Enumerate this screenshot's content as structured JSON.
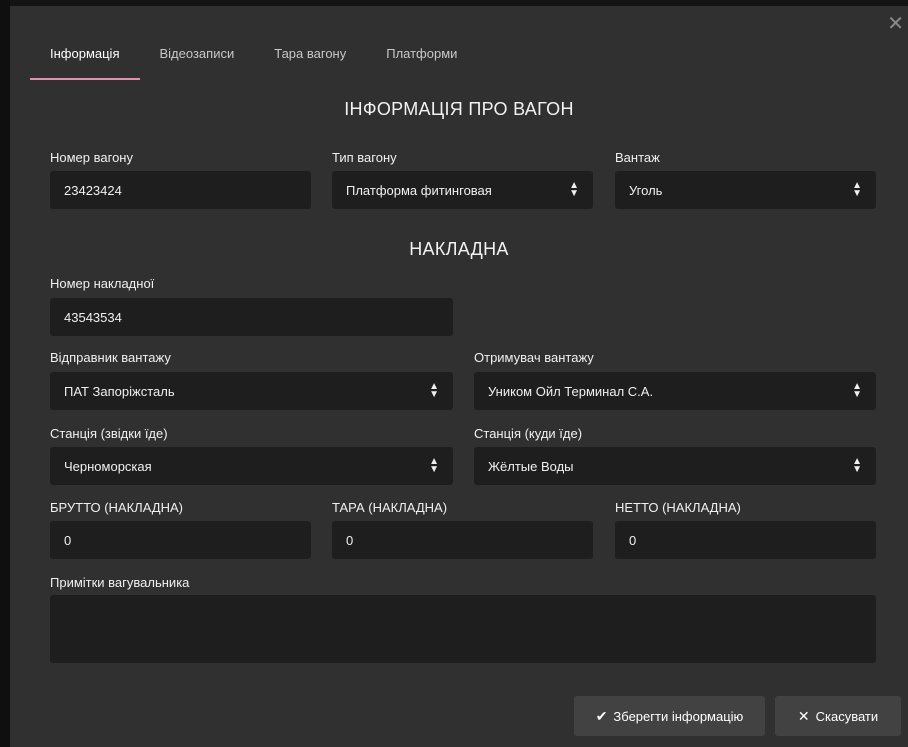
{
  "tabs": [
    {
      "label": "Інформація",
      "active": true
    },
    {
      "label": "Відеозаписи",
      "active": false
    },
    {
      "label": "Тара вагону",
      "active": false
    },
    {
      "label": "Платформи",
      "active": false
    }
  ],
  "wagon_section": {
    "title": "ІНФОРМАЦІЯ ПРО ВАГОН",
    "wagon_number": {
      "label": "Номер вагону",
      "value": "23423424"
    },
    "wagon_type": {
      "label": "Тип вагону",
      "value": "Платформа фитинговая"
    },
    "cargo": {
      "label": "Вантаж",
      "value": "Уголь"
    }
  },
  "invoice_section": {
    "title": "НАКЛАДНА",
    "invoice_number": {
      "label": "Номер накладної",
      "value": "43543534"
    },
    "sender": {
      "label": "Відправник вантажу",
      "value": "ПАТ Запоріжсталь"
    },
    "receiver": {
      "label": "Отримувач вантажу",
      "value": "Уником Ойл Терминал С.А."
    },
    "station_from": {
      "label": "Станція (звідки їде)",
      "value": "Черноморская"
    },
    "station_to": {
      "label": "Станція (куди їде)",
      "value": "Жёлтые Воды"
    },
    "gross": {
      "label": "БРУТТО (НАКЛАДНА)",
      "value": "0"
    },
    "tare": {
      "label": "ТАРА (НАКЛАДНА)",
      "value": "0"
    },
    "net": {
      "label": "НЕТТО (НАКЛАДНА)",
      "value": "0"
    },
    "notes": {
      "label": "Примітки вагувальника",
      "value": ""
    }
  },
  "buttons": {
    "save": "Зберегти інформацію",
    "cancel": "Скасувати"
  },
  "icons": {
    "close": "close-icon",
    "select_arrows": "sort-arrows-icon",
    "check": "check-icon"
  },
  "colors": {
    "accent": "#e58fb0",
    "dialog_bg": "#303030",
    "field_bg": "#1e1e1e",
    "button_bg": "#424242"
  }
}
